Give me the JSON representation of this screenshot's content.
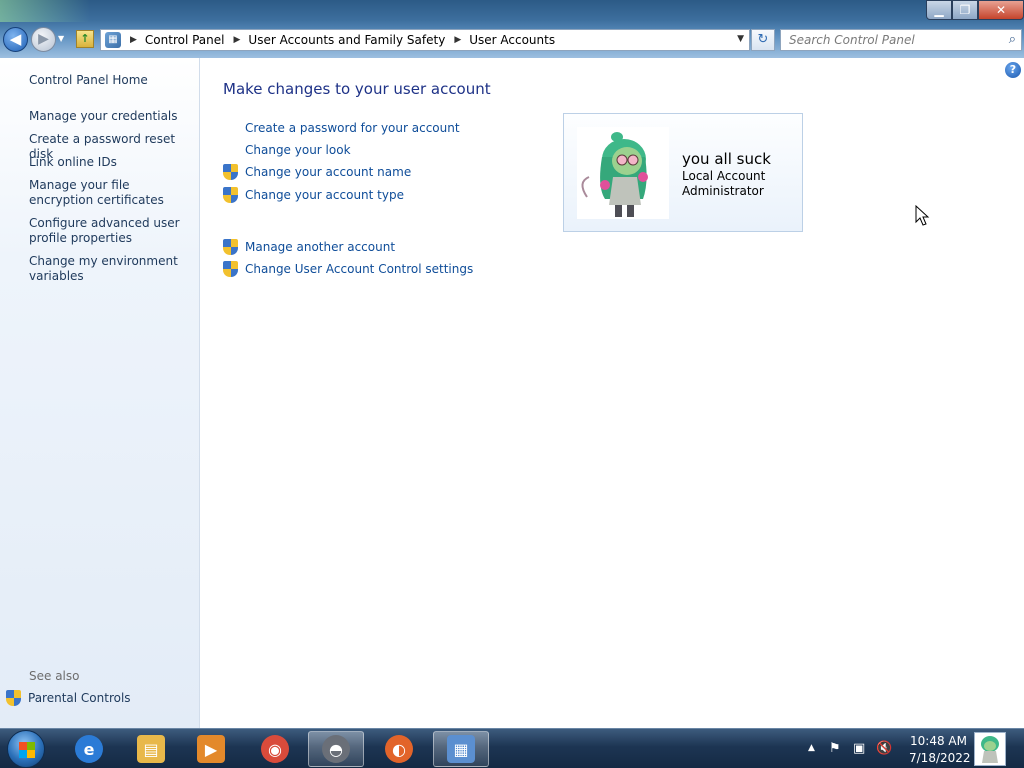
{
  "window": {
    "minimize_glyph": "▁",
    "maximize_glyph": "❐",
    "close_glyph": "✕"
  },
  "nav": {
    "back_glyph": "◀",
    "forward_glyph": "▶",
    "dropdown_glyph": "▼",
    "up_glyph": "↑",
    "refresh_glyph": "↻"
  },
  "breadcrumb": {
    "items": [
      "Control Panel",
      "User Accounts and Family Safety",
      "User Accounts"
    ],
    "separator": "▶"
  },
  "search": {
    "placeholder": "Search Control Panel",
    "icon": "search-icon"
  },
  "sidebar": {
    "home": "Control Panel Home",
    "links": [
      "Manage your credentials",
      "Create a password reset disk",
      "Link online IDs",
      "Manage your file encryption certificates",
      "Configure advanced user profile properties",
      "Change my environment variables"
    ],
    "see_also": "See also",
    "parental_controls": "Parental Controls"
  },
  "main": {
    "title": "Make changes to your user account",
    "tasks": [
      {
        "label": "Create a password for your account",
        "shield": false
      },
      {
        "label": "Change your look",
        "shield": false
      },
      {
        "label": "Change your account name",
        "shield": true
      },
      {
        "label": "Change your account type",
        "shield": true
      }
    ],
    "other_tasks": [
      {
        "label": "Manage another account",
        "shield": true
      },
      {
        "label": "Change User Account Control settings",
        "shield": true
      }
    ],
    "help_glyph": "?"
  },
  "account": {
    "name": "you all suck",
    "type": "Local Account",
    "role": "Administrator"
  },
  "taskbar": {
    "apps": [
      {
        "name": "internet-explorer",
        "glyph": "e",
        "color": "#2b7bd6",
        "active": false
      },
      {
        "name": "windows-explorer",
        "glyph": "▤",
        "color": "#e8b84a",
        "active": false
      },
      {
        "name": "media-player",
        "glyph": "▶",
        "color": "#e3892b",
        "active": false
      },
      {
        "name": "chrome",
        "glyph": "◉",
        "color": "#d94b3b",
        "active": false
      },
      {
        "name": "raccoon-app",
        "glyph": "◓",
        "color": "#6a6f78",
        "active": true
      },
      {
        "name": "firefox",
        "glyph": "◐",
        "color": "#e2642a",
        "active": false
      },
      {
        "name": "control-panel",
        "glyph": "▦",
        "color": "#5b8fd0",
        "active": true
      }
    ],
    "tray": {
      "show_hidden": "▲",
      "flag": "⚑",
      "network": "▣",
      "volume": "🔇"
    },
    "time": "10:48 AM",
    "date": "7/18/2022"
  },
  "colors": {
    "link": "#0f4d99",
    "title": "#1e3287",
    "sidebar_link": "#1e395b"
  }
}
